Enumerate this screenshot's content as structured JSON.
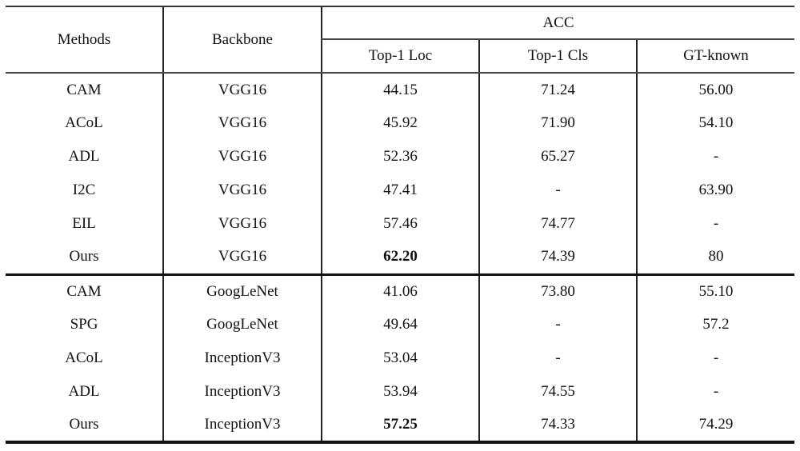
{
  "table": {
    "headers": {
      "methods": "Methods",
      "backbone": "Backbone",
      "group": "ACC",
      "sub": [
        "Top-1 Loc",
        "Top-1 Cls",
        "GT-known"
      ]
    },
    "groups": [
      {
        "rows": [
          {
            "method": "CAM",
            "backbone": "VGG16",
            "top1_loc": "44.15",
            "top1_cls": "71.24",
            "gt_known": "56.00"
          },
          {
            "method": "ACoL",
            "backbone": "VGG16",
            "top1_loc": "45.92",
            "top1_cls": "71.90",
            "gt_known": "54.10"
          },
          {
            "method": "ADL",
            "backbone": "VGG16",
            "top1_loc": "52.36",
            "top1_cls": "65.27",
            "gt_known": "-"
          },
          {
            "method": "I2C",
            "backbone": "VGG16",
            "top1_loc": "47.41",
            "top1_cls": "-",
            "gt_known": "63.90"
          },
          {
            "method": "EIL",
            "backbone": "VGG16",
            "top1_loc": "57.46",
            "top1_cls": "74.77",
            "gt_known": "-"
          },
          {
            "method": "Ours",
            "backbone": "VGG16",
            "top1_loc": "62.20",
            "top1_cls": "74.39",
            "gt_known": "80",
            "bold": "top1_loc"
          }
        ]
      },
      {
        "rows": [
          {
            "method": "CAM",
            "backbone": "GoogLeNet",
            "top1_loc": "41.06",
            "top1_cls": "73.80",
            "gt_known": "55.10"
          },
          {
            "method": "SPG",
            "backbone": "GoogLeNet",
            "top1_loc": "49.64",
            "top1_cls": "-",
            "gt_known": "57.2"
          },
          {
            "method": "ACoL",
            "backbone": "InceptionV3",
            "top1_loc": "53.04",
            "top1_cls": "-",
            "gt_known": "-"
          },
          {
            "method": "ADL",
            "backbone": "InceptionV3",
            "top1_loc": "53.94",
            "top1_cls": "74.55",
            "gt_known": "-"
          },
          {
            "method": "Ours",
            "backbone": "InceptionV3",
            "top1_loc": "57.25",
            "top1_cls": "74.33",
            "gt_known": "74.29",
            "bold": "top1_loc"
          }
        ]
      }
    ]
  }
}
